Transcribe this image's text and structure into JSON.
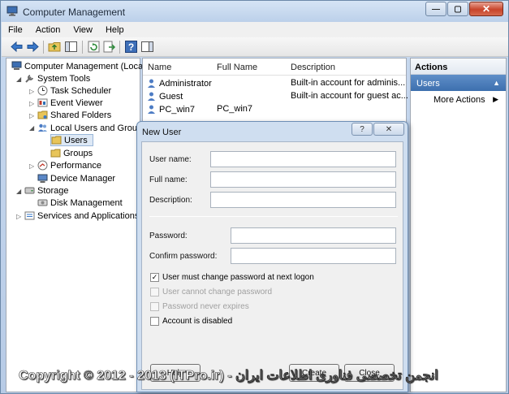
{
  "window": {
    "title": "Computer Management",
    "controls": {
      "minimize": "—",
      "maximize": "▢",
      "close": "✕"
    }
  },
  "menu": [
    "File",
    "Action",
    "View",
    "Help"
  ],
  "tree": {
    "root": "Computer Management (Local",
    "system_tools": "System Tools",
    "task_scheduler": "Task Scheduler",
    "event_viewer": "Event Viewer",
    "shared_folders": "Shared Folders",
    "local_users_groups": "Local Users and Groups",
    "users": "Users",
    "groups": "Groups",
    "performance": "Performance",
    "device_manager": "Device Manager",
    "storage": "Storage",
    "disk_management": "Disk Management",
    "services_apps": "Services and Applications"
  },
  "list": {
    "columns": {
      "name": "Name",
      "full_name": "Full Name",
      "description": "Description"
    },
    "rows": [
      {
        "name": "Administrator",
        "full_name": "",
        "description": "Built-in account for adminis..."
      },
      {
        "name": "Guest",
        "full_name": "",
        "description": "Built-in account for guest ac..."
      },
      {
        "name": "PC_win7",
        "full_name": "PC_win7",
        "description": ""
      }
    ]
  },
  "actions": {
    "header": "Actions",
    "section": "Users",
    "more": "More Actions"
  },
  "dialog": {
    "title": "New User",
    "help_btn": "?",
    "close_btn": "✕",
    "labels": {
      "user_name": "User name:",
      "full_name": "Full name:",
      "description": "Description:",
      "password": "Password:",
      "confirm_password": "Confirm password:"
    },
    "values": {
      "user_name": "",
      "full_name": "",
      "description": "",
      "password": "",
      "confirm_password": ""
    },
    "checkboxes": {
      "must_change": "User must change password at next logon",
      "cannot_change": "User cannot change password",
      "never_expires": "Password never expires",
      "disabled": "Account is disabled"
    },
    "buttons": {
      "help": "Help",
      "create": "Create",
      "close": "Close"
    }
  },
  "watermark": "Copyright © 2012 - 2013 (ITPro.ir) - انجمن تخصصی فناوری اطلاعات ایران"
}
